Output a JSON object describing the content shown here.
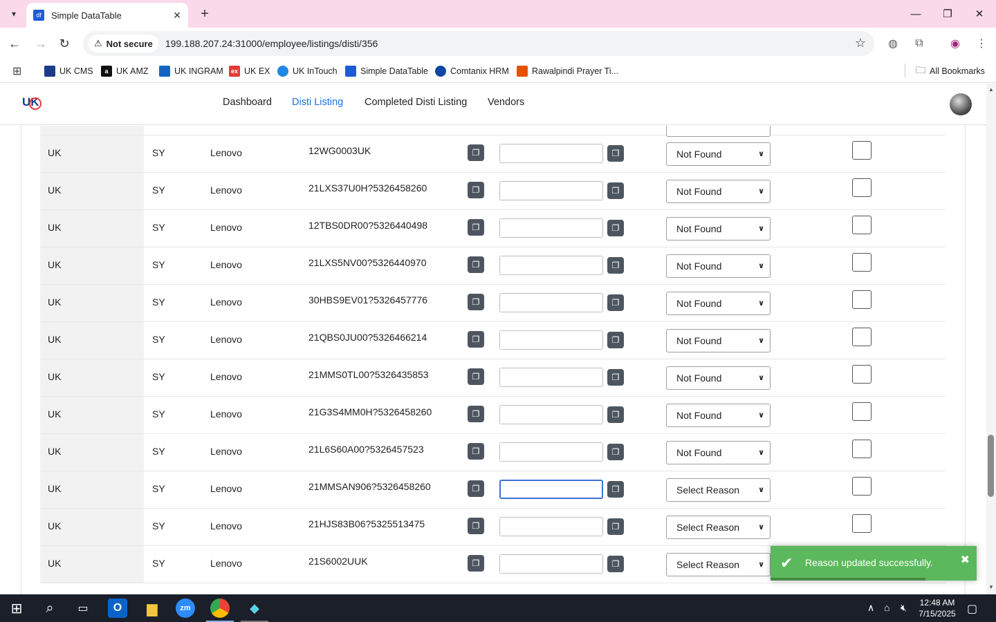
{
  "browser": {
    "tab_title": "Simple DataTable",
    "tab_favicon": "df",
    "security_label": "Not secure",
    "url": "199.188.207.24:31000/employee/listings/disti/356"
  },
  "bookmarks": [
    {
      "label": "UK CMS",
      "icon": "uk-cms-icon",
      "color": "#1e3a8a"
    },
    {
      "label": "UK AMZ",
      "icon": "amazon-icon",
      "color": "#111111"
    },
    {
      "label": "UK INGRAM",
      "icon": "ingram-icon",
      "color": "#1565c0"
    },
    {
      "label": "UK EX",
      "icon": "ex-icon",
      "color": "#e53935"
    },
    {
      "label": "UK InTouch",
      "icon": "intouch-icon",
      "color": "#1e88e5"
    },
    {
      "label": "Simple DataTable",
      "icon": "datatable-icon",
      "color": "#1e5bd6"
    },
    {
      "label": "Comtanix HRM",
      "icon": "comtanix-icon",
      "color": "#0d47a1"
    },
    {
      "label": "Rawalpindi Prayer Ti...",
      "icon": "prayer-icon",
      "color": "#e65100"
    }
  ],
  "all_bookmarks_label": "All Bookmarks",
  "app": {
    "logo_text": "UK",
    "nav": [
      {
        "label": "Dashboard",
        "active": false
      },
      {
        "label": "Disti Listing",
        "active": true
      },
      {
        "label": "Completed Disti Listing",
        "active": false
      },
      {
        "label": "Vendors",
        "active": false
      }
    ]
  },
  "rows": [
    {
      "region": "UK",
      "code": "SY",
      "brand": "Lenovo",
      "part": "12WG0003UK",
      "input": "",
      "reason": "Not Found"
    },
    {
      "region": "UK",
      "code": "SY",
      "brand": "Lenovo",
      "part": "21LXS37U0H?5326458260",
      "input": "",
      "reason": "Not Found"
    },
    {
      "region": "UK",
      "code": "SY",
      "brand": "Lenovo",
      "part": "12TBS0DR00?5326440498",
      "input": "",
      "reason": "Not Found"
    },
    {
      "region": "UK",
      "code": "SY",
      "brand": "Lenovo",
      "part": "21LXS5NV00?5326440970",
      "input": "",
      "reason": "Not Found"
    },
    {
      "region": "UK",
      "code": "SY",
      "brand": "Lenovo",
      "part": "30HBS9EV01?5326457776",
      "input": "",
      "reason": "Not Found"
    },
    {
      "region": "UK",
      "code": "SY",
      "brand": "Lenovo",
      "part": "21QBS0JU00?5326466214",
      "input": "",
      "reason": "Not Found"
    },
    {
      "region": "UK",
      "code": "SY",
      "brand": "Lenovo",
      "part": "21MMS0TL00?5326435853",
      "input": "",
      "reason": "Not Found"
    },
    {
      "region": "UK",
      "code": "SY",
      "brand": "Lenovo",
      "part": "21G3S4MM0H?5326458260",
      "input": "",
      "reason": "Not Found"
    },
    {
      "region": "UK",
      "code": "SY",
      "brand": "Lenovo",
      "part": "21L6S60A00?5326457523",
      "input": "",
      "reason": "Not Found"
    },
    {
      "region": "UK",
      "code": "SY",
      "brand": "Lenovo",
      "part": "21MMSAN906?5326458260",
      "input": "",
      "reason": "Select Reason",
      "focused": true
    },
    {
      "region": "UK",
      "code": "SY",
      "brand": "Lenovo",
      "part": "21HJS83B06?5325513475",
      "input": "",
      "reason": "Select Reason"
    },
    {
      "region": "UK",
      "code": "SY",
      "brand": "Lenovo",
      "part": "21S6002UUK",
      "input": "",
      "reason": "Select Reason"
    }
  ],
  "toast": {
    "message": "Reason updated successfully.",
    "color": "#5cb85c",
    "progress_fraction": 0.75
  },
  "taskbar": {
    "time": "12:48 AM",
    "date": "7/15/2025"
  }
}
